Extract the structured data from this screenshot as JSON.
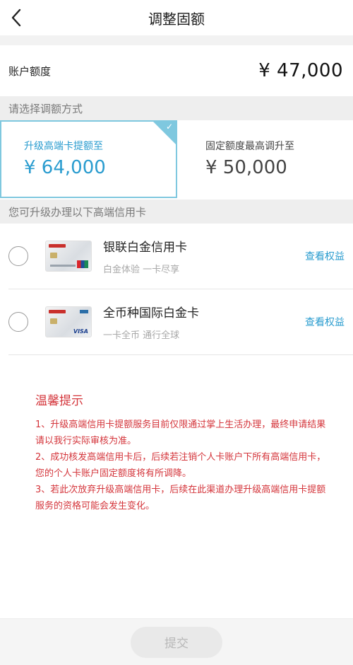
{
  "nav": {
    "title": "调整固额"
  },
  "account": {
    "label": "账户额度",
    "value": "¥ 47,000"
  },
  "method_section": {
    "heading": "请选择调额方式"
  },
  "options": [
    {
      "label": "升级高端卡提额至",
      "amount": "¥ 64,000",
      "selected": true
    },
    {
      "label": "固定额度最高调升至",
      "amount": "¥ 50,000",
      "selected": false
    }
  ],
  "cards_section": {
    "heading": "您可升级办理以下高端信用卡"
  },
  "cards": [
    {
      "name": "银联白金信用卡",
      "subtitle": "白金体验 一卡尽享",
      "link": "查看权益",
      "network": "unionpay"
    },
    {
      "name": "全币种国际白金卡",
      "subtitle": "一卡全币 通行全球",
      "link": "查看权益",
      "network": "visa",
      "network_text": "VISA"
    }
  ],
  "tips": {
    "title": "温馨提示",
    "items": [
      "1、升级高端信用卡提额服务目前仅限通过掌上生活办理，最终申请结果请以我行实际审核为准。",
      "2、成功核发高端信用卡后，后续若注销个人卡账户下所有高端信用卡，您的个人卡账户固定额度将有所调降。",
      "3、若此次放弃升级高端信用卡，后续在此渠道办理升级高端信用卡提额服务的资格可能会发生变化。"
    ]
  },
  "footer": {
    "submit_label": "提交"
  },
  "colors": {
    "accent": "#2a9ccf",
    "selected_border": "#7fc8df",
    "tip_red": "#d4353b"
  },
  "icons": {
    "back": "chevron-left-icon",
    "check": "check-icon"
  }
}
